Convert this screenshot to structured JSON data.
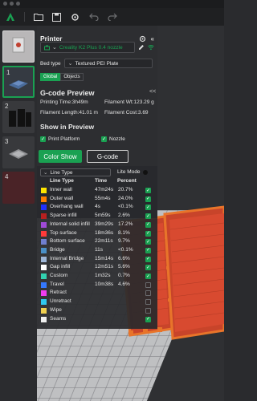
{
  "colors": {
    "accent": "#1aa152",
    "panel": "#2d2e31"
  },
  "toolbar": {
    "icons": [
      "app-logo",
      "open-folder-icon",
      "save-icon",
      "settings-icon",
      "undo-icon",
      "redo-icon"
    ]
  },
  "plates": [
    {
      "num": "",
      "selected": false
    },
    {
      "num": "1",
      "selected": true
    },
    {
      "num": "2",
      "selected": false
    },
    {
      "num": "3",
      "selected": false
    },
    {
      "num": "4",
      "selected": false
    }
  ],
  "printer": {
    "header": "Printer",
    "name": "Creality K2 Plus 0.4 nozzle",
    "bed_label": "Bed type",
    "bed_value": "Textured PEI Plate",
    "tab_global": "Global",
    "tab_objects": "Objects"
  },
  "gcode": {
    "title": "G-code Preview",
    "collapse": "<<",
    "printing_time": "Printing Time:3h49m",
    "filament_wt": "Filament Wt:123.29 g",
    "filament_length": "Filament Length:41.01 m",
    "filament_cost": "Filament Cost:3.69"
  },
  "show": {
    "title": "Show in Preview",
    "print_platform": "Print Platform",
    "nozzle": "Nozzle"
  },
  "buttons": {
    "color_show": "Color Show",
    "gcode": "G-code"
  },
  "legend": {
    "line_type": "Line Type",
    "lite_mode": "Lite Mode",
    "col_line_type": "Line Type",
    "col_time": "Time",
    "col_percent": "Percent",
    "rows": [
      {
        "name": "Inner wall",
        "time": "47m24s",
        "percent": "20.7%",
        "color": "#ffe600",
        "visible": true
      },
      {
        "name": "Outer wall",
        "time": "55m4s",
        "percent": "24.0%",
        "color": "#ff7f00",
        "visible": true
      },
      {
        "name": "Overhang wall",
        "time": "4s",
        "percent": "<0.1%",
        "color": "#2030ff",
        "visible": true
      },
      {
        "name": "Sparse infill",
        "time": "5m59s",
        "percent": "2.6%",
        "color": "#b82020",
        "visible": true
      },
      {
        "name": "Internal solid infill",
        "time": "39m29s",
        "percent": "17.2%",
        "color": "#a04ad8",
        "visible": true
      },
      {
        "name": "Top surface",
        "time": "18m36s",
        "percent": "8.1%",
        "color": "#ff3a3a",
        "visible": true
      },
      {
        "name": "Bottom surface",
        "time": "22m11s",
        "percent": "9.7%",
        "color": "#6f7fd0",
        "visible": true
      },
      {
        "name": "Bridge",
        "time": "11s",
        "percent": "<0.1%",
        "color": "#4a90c8",
        "visible": true
      },
      {
        "name": "Internal Bridge",
        "time": "15m14s",
        "percent": "6.6%",
        "color": "#9fb7d8",
        "visible": true
      },
      {
        "name": "Gap infill",
        "time": "12m51s",
        "percent": "5.6%",
        "color": "#ffffff",
        "visible": true
      },
      {
        "name": "Custom",
        "time": "1m32s",
        "percent": "0.7%",
        "color": "#32d0b0",
        "visible": true
      },
      {
        "name": "Travel",
        "time": "10m38s",
        "percent": "4.6%",
        "color": "#3478ff",
        "visible": false
      },
      {
        "name": "Retract",
        "time": "",
        "percent": "",
        "color": "#f03cf0",
        "visible": false
      },
      {
        "name": "Unretract",
        "time": "",
        "percent": "",
        "color": "#30c8f0",
        "visible": false
      },
      {
        "name": "Wipe",
        "time": "",
        "percent": "",
        "color": "#f0d050",
        "visible": false
      },
      {
        "name": "Seams",
        "time": "",
        "percent": "",
        "color": "#f0f0f0",
        "visible": true
      }
    ]
  }
}
